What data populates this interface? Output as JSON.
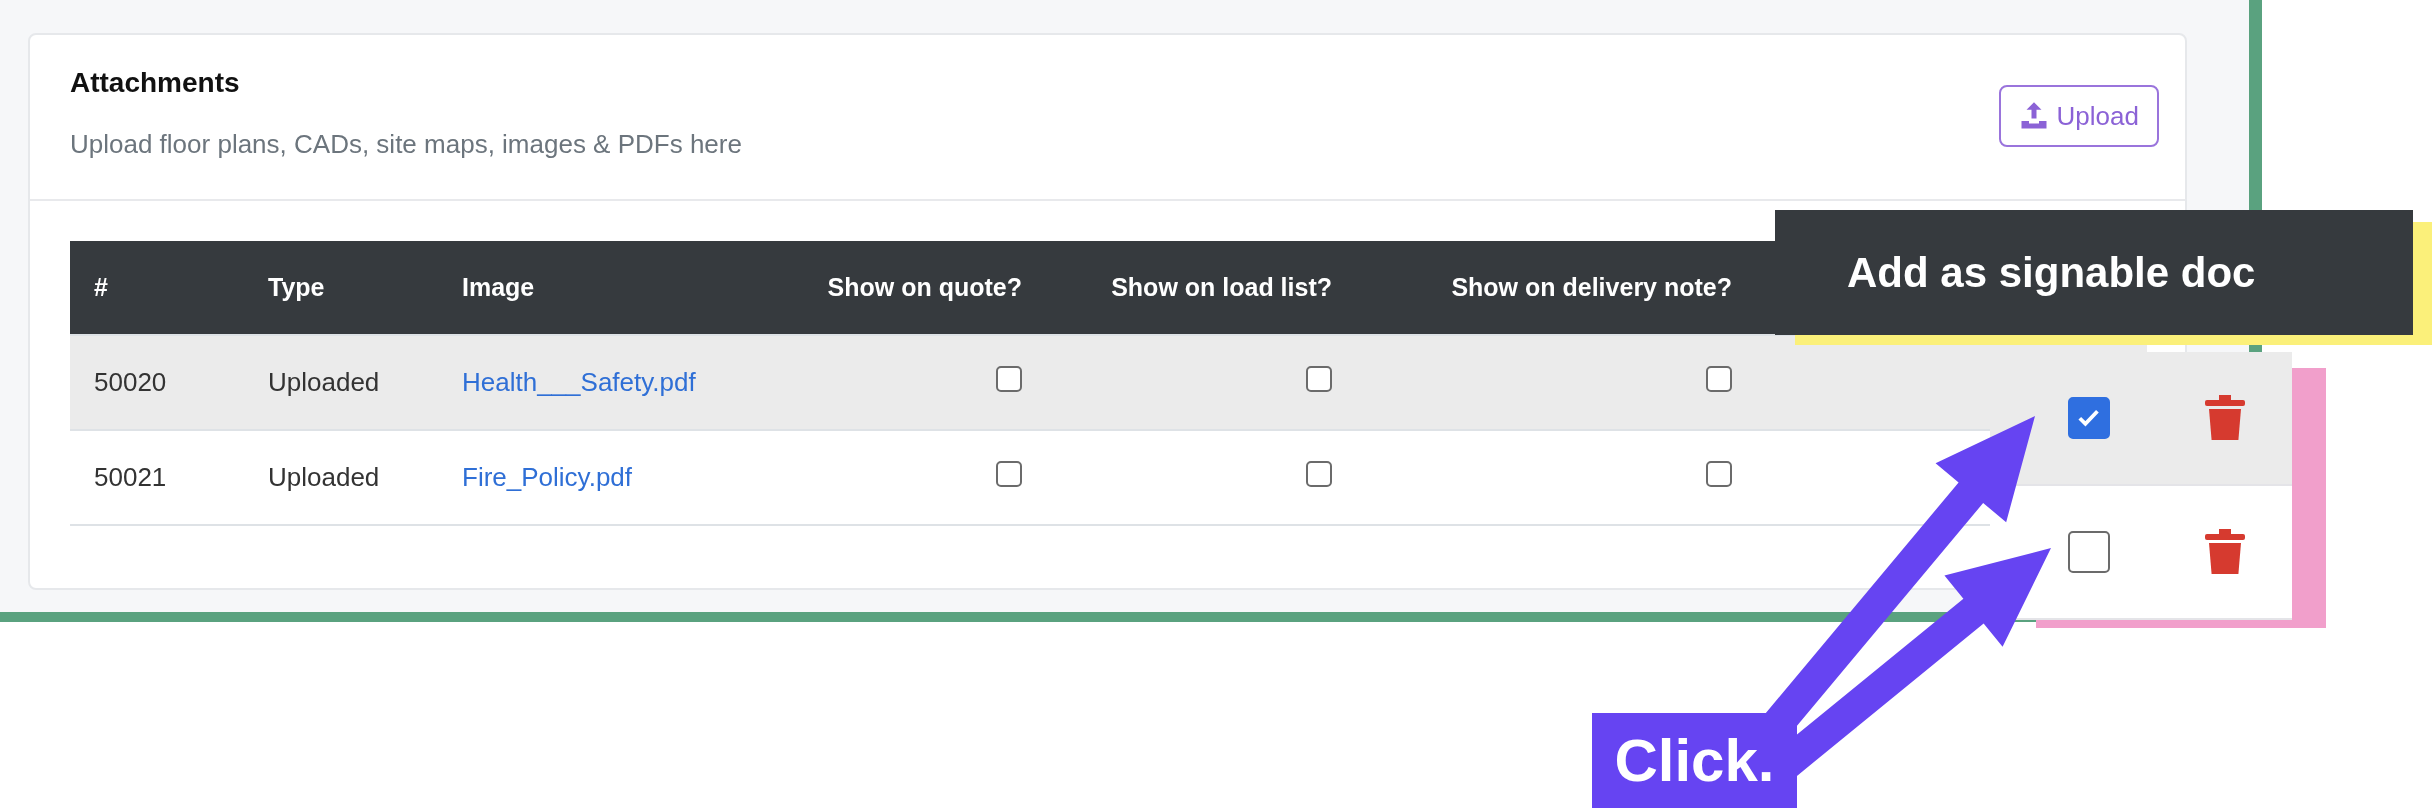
{
  "card": {
    "title": "Attachments",
    "subtitle": "Upload floor plans, CADs, site maps, images & PDFs here",
    "upload_button": "Upload"
  },
  "table": {
    "columns": [
      "#",
      "Type",
      "Image",
      "Show on quote?",
      "Show on load list?",
      "Show on delivery note?"
    ],
    "rows": [
      {
        "id": "50020",
        "type": "Uploaded",
        "file": "Health___Safety.pdf",
        "show_on_quote": false,
        "show_on_load_list": false,
        "show_on_delivery_note": false
      },
      {
        "id": "50021",
        "type": "Uploaded",
        "file": "Fire_Policy.pdf",
        "show_on_quote": false,
        "show_on_load_list": false,
        "show_on_delivery_note": false
      }
    ]
  },
  "signable_panel": {
    "rows": [
      {
        "checked": true
      },
      {
        "checked": false
      }
    ]
  },
  "annotations": {
    "banner": "Add as signable doc",
    "callout": "Click."
  }
}
